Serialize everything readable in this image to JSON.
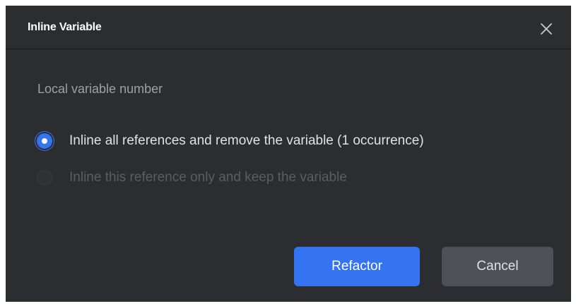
{
  "dialog": {
    "title": "Inline Variable",
    "close_icon": "close-icon",
    "subtitle": "Local variable number",
    "options": [
      {
        "label": "Inline all references and remove the variable (1 occurrence)",
        "selected": true,
        "enabled": true
      },
      {
        "label": "Inline this reference only and keep the variable",
        "selected": false,
        "enabled": false
      }
    ],
    "buttons": {
      "refactor_label": "Refactor",
      "cancel_label": "Cancel"
    }
  },
  "colors": {
    "background": "#2b2d30",
    "accent": "#3574f0",
    "secondary_button": "#4e5157",
    "text": "#dfe1e5",
    "muted_text": "#9da0a8",
    "disabled_text": "#5a5d63"
  }
}
